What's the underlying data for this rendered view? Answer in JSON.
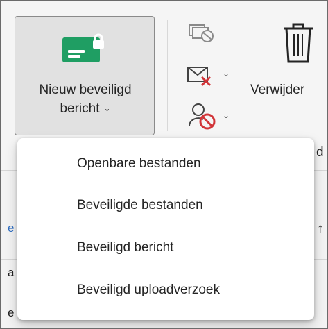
{
  "ribbon": {
    "new_secure_message": {
      "line1": "Nieuw beveiligd",
      "line2": "bericht",
      "chevron": "⌄",
      "icon": "secure-envelope-icon"
    },
    "small_icons": [
      "ignore-conversation-icon",
      "delete-mail-icon",
      "block-sender-icon"
    ],
    "delete_label": "Verwijder"
  },
  "background": {
    "fragment_right_mid": "d",
    "fragment_right_list": "↑",
    "fragment_left_a": "a",
    "fragment_left_b": "e",
    "fragment_link": "e"
  },
  "dropdown": {
    "items": [
      "Openbare bestanden",
      "Beveiligde bestanden",
      "Beveiligd bericht",
      "Beveiligd uploadverzoek"
    ]
  },
  "colors": {
    "accent_green": "#22a36a",
    "delete_red": "#d13438",
    "menu_bg": "#ffffff"
  }
}
